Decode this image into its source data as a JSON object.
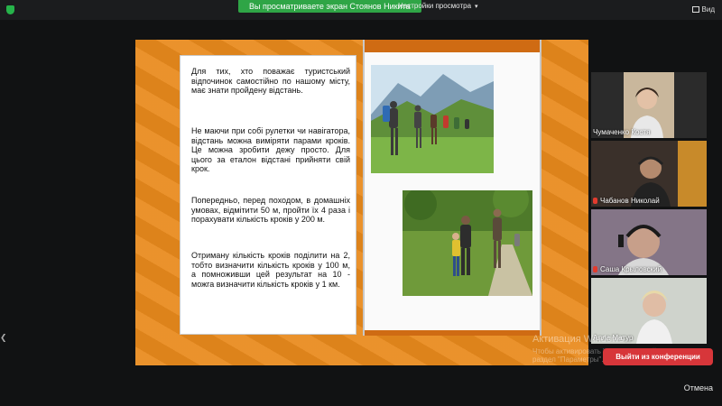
{
  "top_bar": {
    "viewing_banner": "Вы просматриваете экран Стоянов Никита",
    "view_options": "Настройки просмотра",
    "view_button": "Вид"
  },
  "slide": {
    "paragraphs": [
      "Для тих, хто поважає туристський відпочинок самостійно по нашому місту, має знати пройдену відстань.",
      "Не маючи при собі рулетки чи навігатора, відстань можна виміряти парами кроків. Це можна зробити дежу просто. Для цього за еталон відстані прийняти свій крок.",
      "Попередньо, перед походом, в домашніх умовах, відмітити 50 м, пройти їх 4 раза і порахувати кількість кроків у 200 м.",
      "Отриману кількість кроків поділити на 2, тобто визначити кількість кроків у 100 м, а помноживши цей результат на 10 - можга визначити кількість кроків у 1 км."
    ]
  },
  "participants": [
    {
      "name": "Чумаченко Костя",
      "muted": false
    },
    {
      "name": "Чабанов Николай",
      "muted": true
    },
    {
      "name": "Саша Крыловский",
      "muted": true
    },
    {
      "name": "Алла Матур",
      "muted": false
    }
  ],
  "activation": {
    "title": "Активация Windows",
    "subtitle": "Чтобы активировать Windows, перейдите в раздел \"Параметры\"."
  },
  "leave_button": "Выйти из конференции",
  "cancel_label": "Отмена"
}
